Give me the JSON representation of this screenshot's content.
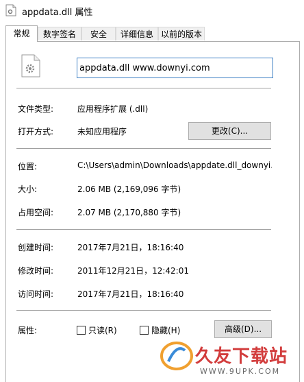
{
  "window": {
    "title": "appdata.dll 属性"
  },
  "tabs": [
    {
      "label": "常规"
    },
    {
      "label": "数字签名"
    },
    {
      "label": "安全"
    },
    {
      "label": "详细信息"
    },
    {
      "label": "以前的版本"
    }
  ],
  "general": {
    "filename": "appdata.dll www.downyi.com",
    "file_type_label": "文件类型:",
    "file_type_value": "应用程序扩展 (.dll)",
    "opens_with_label": "打开方式:",
    "opens_with_value": "未知应用程序",
    "change_button": "更改(C)...",
    "location_label": "位置:",
    "location_value": "C:\\Users\\admin\\Downloads\\appdate.dll_downyi.c",
    "size_label": "大小:",
    "size_value": "2.06 MB (2,169,096 字节)",
    "size_on_disk_label": "占用空间:",
    "size_on_disk_value": "2.07 MB (2,170,880 字节)",
    "created_label": "创建时间:",
    "created_value": "2017年7月21日，18:16:40",
    "modified_label": "修改时间:",
    "modified_value": "2011年12月21日，12:42:01",
    "accessed_label": "访问时间:",
    "accessed_value": "2017年7月21日，18:16:40",
    "attributes_label": "属性:",
    "readonly_label": "只读(R)",
    "hidden_label": "隐藏(H)",
    "advanced_button": "高级(D)..."
  },
  "watermark": {
    "text": "久友下载站",
    "sub": "WWW.9UPK.COM"
  }
}
